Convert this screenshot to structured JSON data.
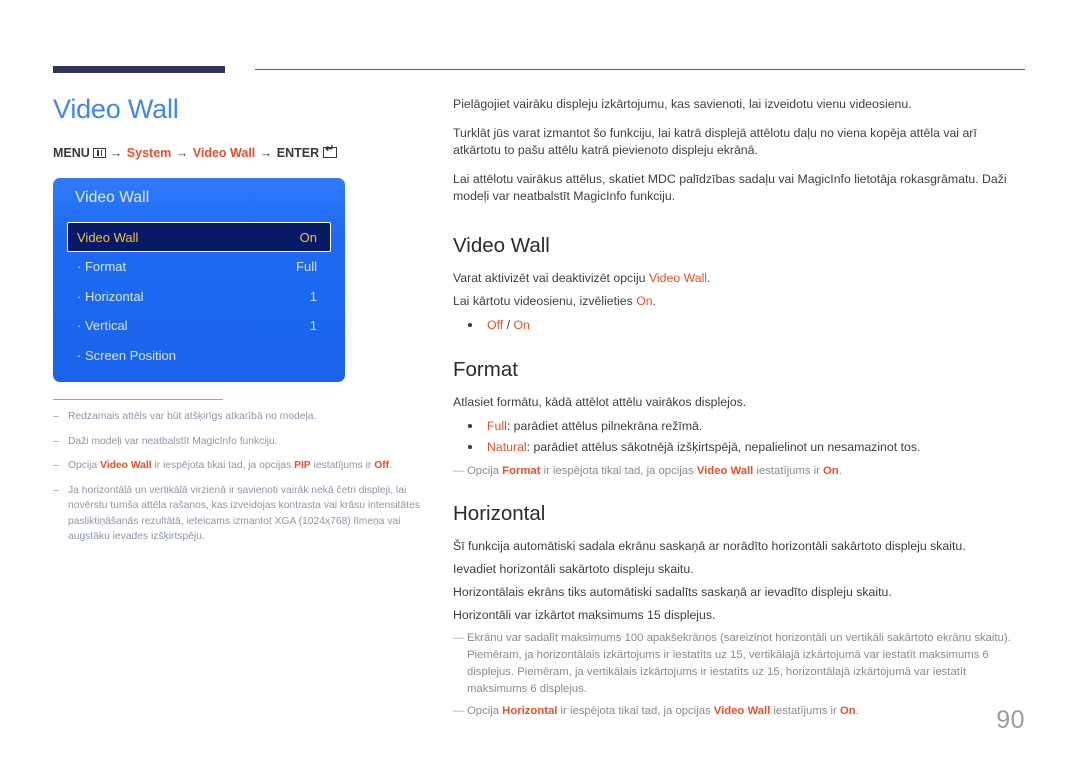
{
  "header": {
    "rule_accent_color": "#2e3757",
    "rule_line_color": "#5a6078"
  },
  "left": {
    "page_title": "Video Wall",
    "menu_path": {
      "prefix": "MENU",
      "menu_icon": "menu-grid-icon",
      "arrow1": "→",
      "item1": "System",
      "arrow2": "→",
      "item2": "Video Wall",
      "arrow3": "→",
      "enter": "ENTER",
      "enter_icon": "enter-key-icon"
    },
    "osd": {
      "title": "Video Wall",
      "rows": [
        {
          "label": "Video Wall",
          "value": "On",
          "selected": true
        },
        {
          "label": "· Format",
          "value": "Full",
          "selected": false
        },
        {
          "label": "· Horizontal",
          "value": "1",
          "selected": false
        },
        {
          "label": "· Vertical",
          "value": "1",
          "selected": false
        },
        {
          "label": "· Screen Position",
          "value": "",
          "selected": false
        }
      ],
      "panel_color": "#1c69f0",
      "selected_color": "#081a66",
      "selected_text_color": "#f2c14b"
    },
    "footnotes": [
      {
        "dash": "–",
        "parts": [
          {
            "t": "Redzamais attēls var būt atšķirīgs atkarībā no modeļa.",
            "hl": false
          }
        ]
      },
      {
        "dash": "–",
        "parts": [
          {
            "t": "Daži modeļi var neatbalstīt MagicInfo funkciju.",
            "hl": false
          }
        ]
      },
      {
        "dash": "–",
        "parts": [
          {
            "t": "Opcija ",
            "hl": false
          },
          {
            "t": "Video Wall",
            "hl": true
          },
          {
            "t": " ir iespējota tikai tad, ja opcijas ",
            "hl": false
          },
          {
            "t": "PIP",
            "hl": true
          },
          {
            "t": " iestatījums ir ",
            "hl": false
          },
          {
            "t": "Off",
            "hl": true
          },
          {
            "t": ".",
            "hl": false
          }
        ]
      },
      {
        "dash": "–",
        "parts": [
          {
            "t": "Ja horizontālā un vertikālā virzienā ir savienoti vairāk nekā četri displeji, lai novērstu tumša attēla rašanos, kas izveidojas kontrasta vai krāsu intensitātes pasliktiņāšanās rezultātā, ieteicams izmantot XGA (1024x768) līmeņa vai augstāku ievades izšķirtspēju.",
            "hl": false
          }
        ]
      }
    ]
  },
  "right": {
    "intro": [
      "Pielāgojiet vairāku displeju izkārtojumu, kas savienoti, lai izveidotu vienu videosienu.",
      "Turklāt jūs varat izmantot šo funkciju, lai katrā displejā attēlotu daļu no viena kopēja attēla vai arī atkārtotu to pašu attēlu katrā pievienoto displeju ekrānā.",
      "Lai attēlotu vairākus attēlus, skatiet MDC palīdzības sadaļu vai MagicInfo lietotāja rokasgrāmatu. Daži modeļi var neatbalstīt MagicInfo funkciju."
    ],
    "sections": [
      {
        "title": "Video Wall",
        "lines": [
          [
            {
              "t": "Varat aktivizēt vai deaktivizēt opciju ",
              "hl": false
            },
            {
              "t": "Video Wall",
              "hl": true
            },
            {
              "t": ".",
              "hl": false
            }
          ],
          [
            {
              "t": "Lai kārtotu videosienu, izvēlieties ",
              "hl": false
            },
            {
              "t": "On",
              "hl": true
            },
            {
              "t": ".",
              "hl": false
            }
          ]
        ],
        "bullets": [
          [
            {
              "t": "Off",
              "hl": true
            },
            {
              "t": " / ",
              "hl": false
            },
            {
              "t": "On",
              "hl": true
            }
          ]
        ],
        "notes": []
      },
      {
        "title": "Format",
        "lines": [
          [
            {
              "t": "Atlasiet formātu, kādā attēlot attēlu vairākos displejos.",
              "hl": false
            }
          ]
        ],
        "bullets": [
          [
            {
              "t": "Full",
              "hl": true
            },
            {
              "t": ": parādiet attēlus pilnekrāna režīmā.",
              "hl": false
            }
          ],
          [
            {
              "t": "Natural",
              "hl": true
            },
            {
              "t": ": parādiet attēlus sākotnējā izšķirtspējā, nepalielinot un nesamazinot tos.",
              "hl": false
            }
          ]
        ],
        "notes": [
          {
            "tick": "—",
            "parts": [
              {
                "t": "Opcija ",
                "hl": false
              },
              {
                "t": "Format",
                "hl": true
              },
              {
                "t": " ir iespējota tikai tad, ja opcijas ",
                "hl": false
              },
              {
                "t": "Video Wall",
                "hl": true
              },
              {
                "t": " iestatījums ir ",
                "hl": false
              },
              {
                "t": "On",
                "hl": true
              },
              {
                "t": ".",
                "hl": false
              }
            ]
          }
        ]
      },
      {
        "title": "Horizontal",
        "lines": [
          [
            {
              "t": "Šī funkcija automātiski sadala ekrānu saskaņā ar norādīto horizontāli sakārtoto displeju skaitu.",
              "hl": false
            }
          ],
          [
            {
              "t": "Ievadiet horizontāli sakārtoto displeju skaitu.",
              "hl": false
            }
          ],
          [
            {
              "t": "Horizontālais ekrāns tiks automātiski sadalīts saskaņā ar ievadīto displeju skaitu.",
              "hl": false
            }
          ],
          [
            {
              "t": "Horizontāli var izkārtot maksimums 15 displejus.",
              "hl": false
            }
          ]
        ],
        "bullets": [],
        "notes": [
          {
            "tick": "—",
            "parts": [
              {
                "t": "Ekrānu var sadalīt maksimums 100 apakšekrānos (sareizinot horizontāli un vertikāli sakārtoto ekrānu skaitu). Piemēram, ja horizontālais izkārtojums ir iestatīts uz 15, vertikālajā izkārtojumā var iestatīt maksimums 6 displejus. Piemēram, ja vertikālais izkārtojums ir iestatīts uz 15, horizontālajā izkārtojumā var iestatīt maksimums 6 displejus.",
                "hl": false
              }
            ]
          },
          {
            "tick": "—",
            "parts": [
              {
                "t": "Opcija ",
                "hl": false
              },
              {
                "t": "Horizontal",
                "hl": true
              },
              {
                "t": " ir iespējota tikai tad, ja opcijas ",
                "hl": false
              },
              {
                "t": "Video Wall",
                "hl": true
              },
              {
                "t": " iestatījums ir ",
                "hl": false
              },
              {
                "t": "On",
                "hl": true
              },
              {
                "t": ".",
                "hl": false
              }
            ]
          }
        ]
      }
    ]
  },
  "footer": {
    "page_number": "90"
  },
  "colors": {
    "accent_red": "#e8502a",
    "title_blue": "#4285f4",
    "navy": "#2e3757",
    "osd_blue": "#1c69f0"
  }
}
